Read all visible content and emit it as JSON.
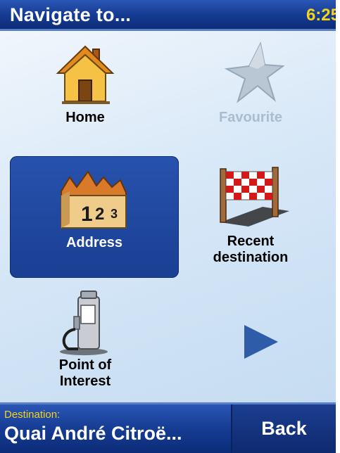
{
  "header": {
    "title": "Navigate to...",
    "clock": "6:25"
  },
  "menu": {
    "home": {
      "label": "Home",
      "icon": "house-icon"
    },
    "favourite": {
      "label": "Favourite",
      "icon": "star-icon",
      "enabled": false
    },
    "address": {
      "label": "Address",
      "icon": "address-blocks-icon",
      "selected": true
    },
    "recent": {
      "line1": "Recent",
      "line2": "destination",
      "icon": "checkered-flag-icon"
    },
    "poi": {
      "line1": "Point of",
      "line2": "Interest",
      "icon": "fuel-pump-icon"
    },
    "next": {
      "icon": "next-arrow-icon"
    }
  },
  "footer": {
    "destination_caption": "Destination:",
    "destination_value": "Quai André Citroë...",
    "back_label": "Back"
  },
  "colors": {
    "bar_blue": "#143a90",
    "clock_yellow": "#f5d21a",
    "selected_tile": "#1f4aa3",
    "background": "#d6e7f7"
  }
}
